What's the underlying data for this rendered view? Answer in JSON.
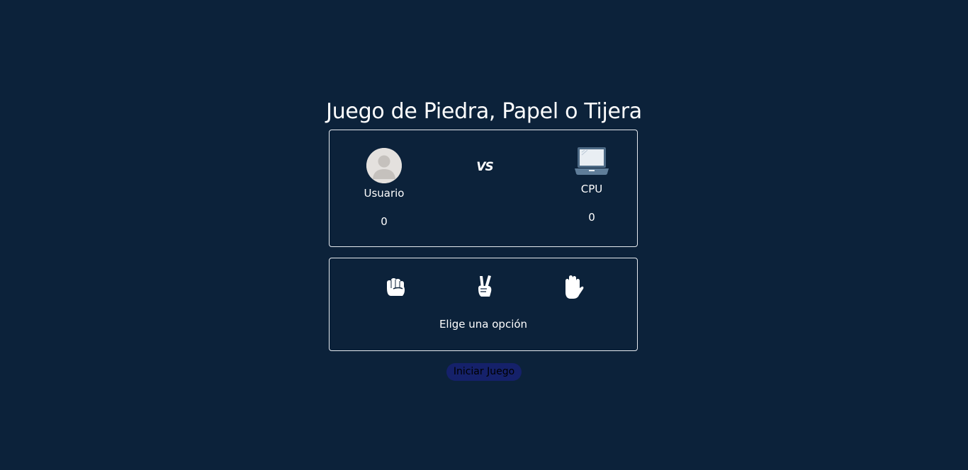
{
  "page": {
    "title": "Juego de Piedra, Papel o Tijera",
    "background_color": "#0c223a"
  },
  "scoreboard": {
    "user": {
      "icon": "user-avatar-icon",
      "name": "Usuario",
      "score": "0"
    },
    "versus_label": "VS",
    "cpu": {
      "icon": "laptop-icon",
      "name": "CPU",
      "score": "0"
    }
  },
  "choices": {
    "options": [
      {
        "icon": "rock-fist-icon",
        "meaning": "piedra"
      },
      {
        "icon": "scissors-hand-icon",
        "meaning": "tijera"
      },
      {
        "icon": "paper-hand-icon",
        "meaning": "papel"
      }
    ],
    "prompt": "Elige una opción"
  },
  "actions": {
    "start_label": "Iniciar Juego",
    "start_color": "#15216a"
  }
}
